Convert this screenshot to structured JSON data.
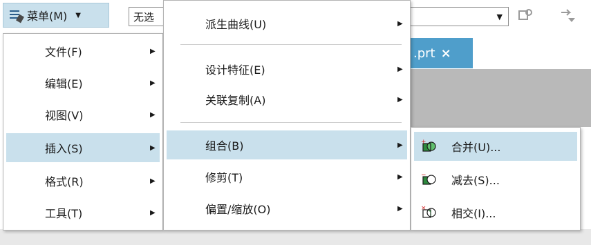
{
  "toolbar": {
    "menu_label": "菜单(M)",
    "selection_value": "无选",
    "menu_icon": "menu-icon",
    "caret_icon": "caret-down-icon",
    "dropdown_icon": "dropdown-arrow-icon"
  },
  "file_tab": {
    "label": ".prt",
    "close": "×"
  },
  "main_menu": {
    "items": [
      {
        "label": "文件(F)"
      },
      {
        "label": "编辑(E)"
      },
      {
        "label": "视图(V)"
      },
      {
        "label": "插入(S)",
        "highlighted": true
      },
      {
        "label": "格式(R)"
      },
      {
        "label": "工具(T)"
      }
    ]
  },
  "insert_menu": {
    "items": [
      {
        "label": "派生曲线(U)"
      },
      {
        "label": "设计特征(E)"
      },
      {
        "label": "关联复制(A)"
      },
      {
        "label": "组合(B)",
        "highlighted": true
      },
      {
        "label": "修剪(T)"
      },
      {
        "label": "偏置/缩放(O)"
      }
    ]
  },
  "combine_menu": {
    "items": [
      {
        "label": "合并(U)...",
        "icon": "unite-icon",
        "highlighted": true
      },
      {
        "label": "减去(S)...",
        "icon": "subtract-icon"
      },
      {
        "label": "相交(I)...",
        "icon": "intersect-icon"
      }
    ]
  },
  "colors": {
    "highlight": "#c9e0ec",
    "tab_active": "#4f9ecb",
    "viewport_gray": "#b9b9b9"
  }
}
